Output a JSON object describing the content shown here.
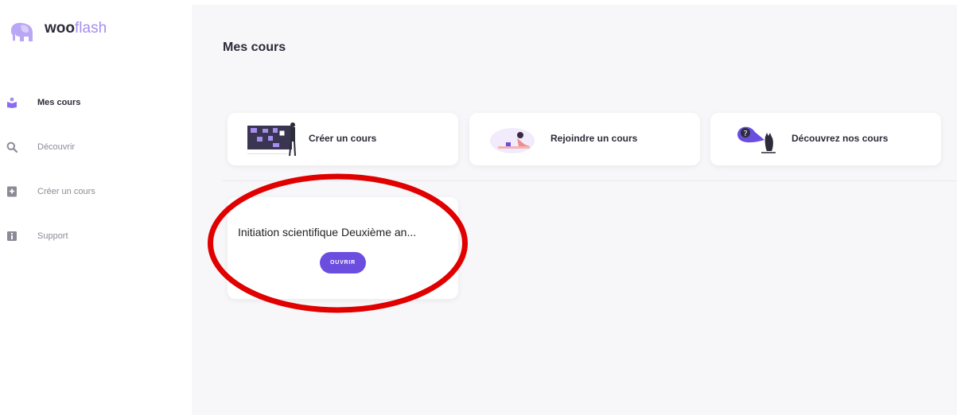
{
  "brand": {
    "name_bold": "woo",
    "name_light": "flash"
  },
  "sidebar": {
    "items": [
      {
        "label": "Mes cours",
        "icon": "book-reader-icon",
        "active": true
      },
      {
        "label": "Découvrir",
        "icon": "search-icon",
        "active": false
      },
      {
        "label": "Créer un cours",
        "icon": "add-book-icon",
        "active": false
      },
      {
        "label": "Support",
        "icon": "info-icon",
        "active": false
      }
    ]
  },
  "main": {
    "title": "Mes cours",
    "actions": [
      {
        "label": "Créer un cours",
        "icon": "presentation-board-illustration"
      },
      {
        "label": "Rejoindre un cours",
        "icon": "person-reading-illustration"
      },
      {
        "label": "Découvrez nos cours",
        "icon": "cat-spotlight-illustration"
      }
    ],
    "courses": [
      {
        "title": "Initiation scientifique Deuxième an...",
        "button_label": "OUVRIR"
      }
    ]
  },
  "colors": {
    "accent": "#6b4ee0",
    "brand_light": "#a58ef0",
    "annotation": "#e00000",
    "background": "#f7f7f9"
  }
}
